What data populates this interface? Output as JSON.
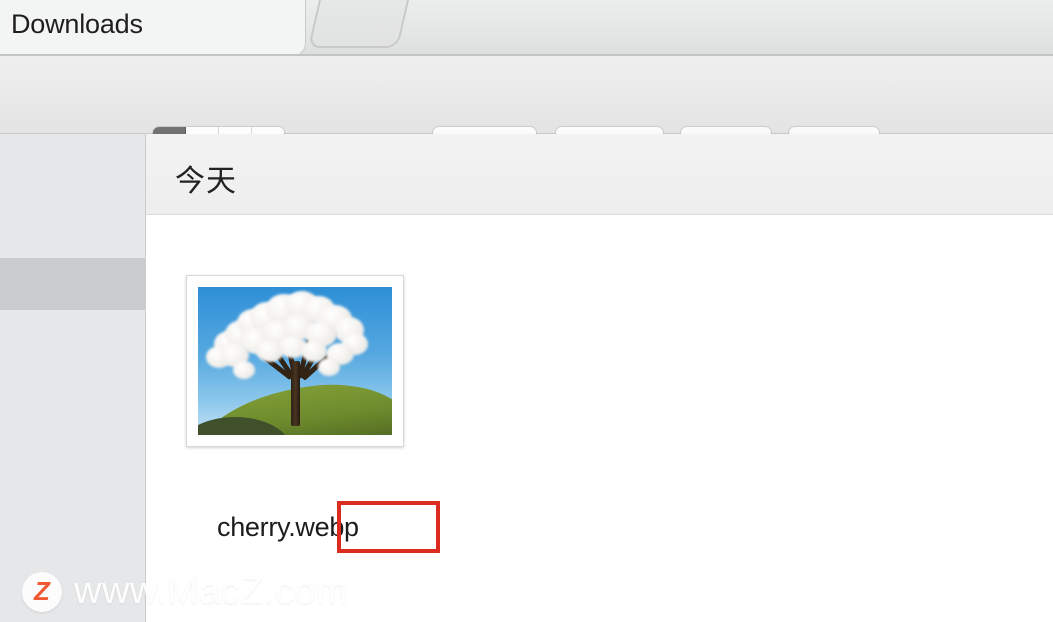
{
  "window": {
    "title": "Downloads",
    "tabs": [
      {
        "label": "Downloads",
        "active": true
      },
      {
        "label": "",
        "active": false,
        "icon": "new-tab-button"
      }
    ]
  },
  "toolbar": {
    "view_modes": [
      {
        "name": "icon-view",
        "icon": "grid-icon",
        "selected": true
      },
      {
        "name": "list-view",
        "icon": "list-icon",
        "selected": false
      },
      {
        "name": "column-view",
        "icon": "columns-icon",
        "selected": false
      },
      {
        "name": "gallery-view",
        "icon": "coverflow-icon",
        "selected": false
      }
    ],
    "arrange_button": {
      "name": "arrange-by",
      "icon": "arrange-icon",
      "chevron": "chevron-down-icon"
    },
    "action_button": {
      "name": "action-menu",
      "icon": "gear-icon",
      "chevron": "chevron-down-icon"
    },
    "share_button": {
      "name": "share",
      "icon": "share-icon",
      "enabled": false
    },
    "tags_button": {
      "name": "tags",
      "icon": "tag-icon",
      "enabled": false
    }
  },
  "sidebar": {
    "selected_row_visible": true
  },
  "content": {
    "group_header": "今天",
    "files": [
      {
        "filename": "cherry.webp",
        "thumbnail_alt": "cherry blossom tree on a green hill under a blue sky",
        "selected": false
      }
    ],
    "annotation": {
      "type": "red-highlight-rectangle",
      "color": "#dc2b21",
      "targets": ".webp"
    }
  },
  "watermark": {
    "logo_letter": "Z",
    "text": "www.MacZ.com",
    "logo_color": "#f05a32"
  }
}
